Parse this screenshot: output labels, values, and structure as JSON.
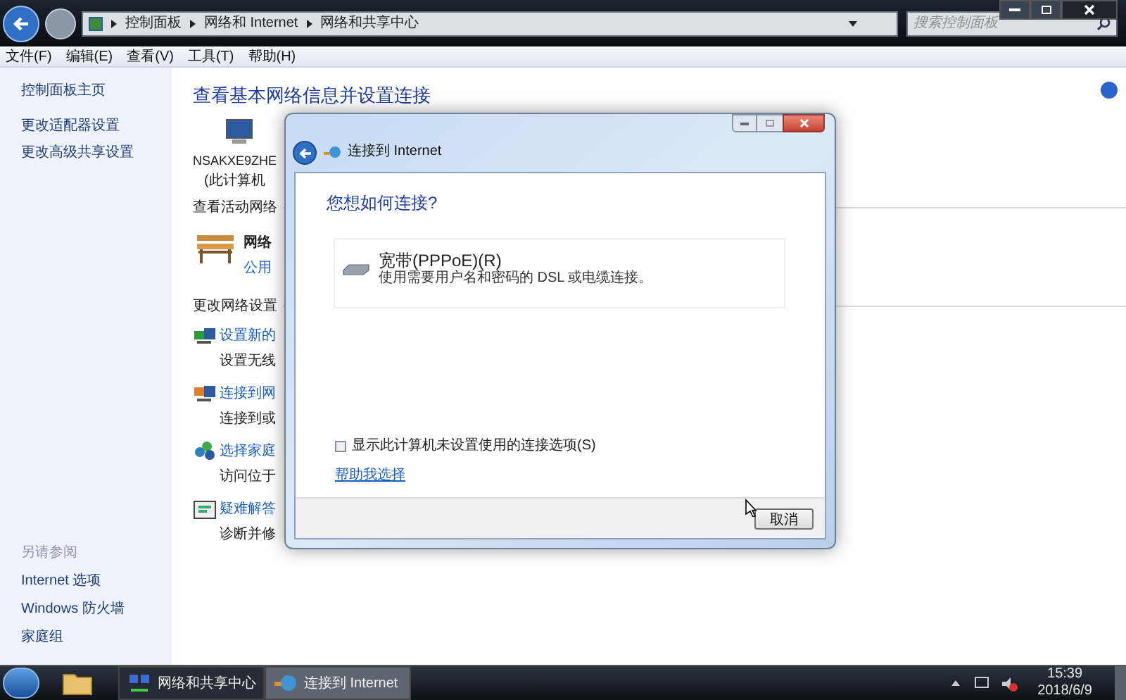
{
  "window": {
    "breadcrumb": [
      "控制面板",
      "网络和 Internet",
      "网络和共享中心"
    ],
    "search": {
      "placeholder": "搜索控制面板"
    }
  },
  "menu": [
    "文件(F)",
    "编辑(E)",
    "查看(V)",
    "工具(T)",
    "帮助(H)"
  ],
  "sidebar": {
    "links": [
      "控制面板主页",
      "更改适配器设置",
      "更改高级共享设置"
    ],
    "see_also_title": "另请参阅",
    "see_also": [
      "Internet 选项",
      "Windows 防火墙",
      "家庭组"
    ]
  },
  "main": {
    "title": "查看基本网络信息并设置连接",
    "computer_name": "NSAKXE9ZHE",
    "computer_caption": "(此计算机",
    "active_heading": "查看活动网络",
    "network_name": "网络",
    "network_type": "公用",
    "change_heading": "更改网络设置",
    "tasks": [
      {
        "kind": "setup",
        "link": "设置新的",
        "desc": "设置无线"
      },
      {
        "kind": "connect",
        "link": "连接到网",
        "desc": "连接到或"
      },
      {
        "kind": "homegroup",
        "link": "选择家庭",
        "desc": "访问位于"
      },
      {
        "kind": "troubleshoot",
        "link": "疑难解答",
        "desc": "诊断并修"
      }
    ]
  },
  "dialog": {
    "title": "连接到 Internet",
    "heading": "您想如何连接?",
    "options": [
      {
        "title": "宽带(PPPoE)(R)",
        "description": "使用需要用户名和密码的 DSL 或电缆连接。"
      }
    ],
    "show_unused": {
      "label": "显示此计算机未设置使用的连接选项(S)",
      "checked": false
    },
    "help_link": "帮助我选择",
    "cancel": "取消"
  },
  "taskbar": {
    "items": [
      {
        "label": "网络和共享中心",
        "selected": false
      },
      {
        "label": "连接到 Internet",
        "selected": true
      }
    ],
    "time": "15:39",
    "date": "2018/6/9"
  }
}
